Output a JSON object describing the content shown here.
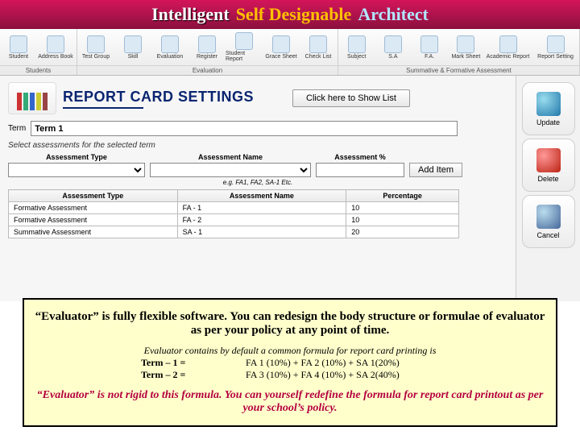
{
  "banner": {
    "w1": "Intelligent",
    "w2": "Self Designable",
    "w3": "Architect"
  },
  "toolbar": {
    "g1": {
      "items": [
        "Student",
        "Address Book"
      ],
      "label": "Students"
    },
    "g2": {
      "items": [
        "Test Group",
        "Skill",
        "Evaluation",
        "Register",
        "Student Report",
        "Grace Sheet",
        "Check List"
      ],
      "label": "Evaluation"
    },
    "g3": {
      "items": [
        "Subject",
        "S.A",
        "F.A.",
        "Mark Sheet",
        "Academic Report",
        "Report Setting"
      ],
      "label": "Summative & Formative Assessment"
    }
  },
  "page_title": "REPORT CARD SETTINGS",
  "show_list": "Click here to Show List",
  "side": {
    "update": "Update",
    "delete": "Delete",
    "cancel": "Cancel"
  },
  "term_label": "Term",
  "term_value": "Term 1",
  "select_instr": "Select assessments for the selected term",
  "cols": {
    "at": "Assessment Type",
    "an": "Assessment Name",
    "ap": "Assessment %"
  },
  "add_item": "Add Item",
  "eg": "e.g. FA1, FA2, SA-1 Etc.",
  "table_head": {
    "c1": "Assessment Type",
    "c2": "Assessment Name",
    "c3": "Percentage"
  },
  "table_rows": [
    {
      "at": "Formative Assessment",
      "an": "FA - 1",
      "pc": "10"
    },
    {
      "at": "Formative Assessment",
      "an": "FA - 2",
      "pc": "10"
    },
    {
      "at": "Summative Assessment",
      "an": "SA - 1",
      "pc": "20"
    }
  ],
  "footer": {
    "p1": "“Evaluator” is fully flexible software. You can redesign the body structure or formulae of evaluator as per your policy at any point of time.",
    "p2": "Evaluator contains by default a common formula for report card printing is",
    "t1l": "Term – 1  =",
    "t1r": "FA 1 (10%) + FA 2 (10%) + SA 1(20%)",
    "t2l": "Term – 2  =",
    "t2r": "FA 3 (10%) + FA 4 (10%) + SA 2(40%)",
    "p3": "“Evaluator” is not rigid to this formula. You can yourself redefine the formula for report card printout as per your school’s policy."
  }
}
